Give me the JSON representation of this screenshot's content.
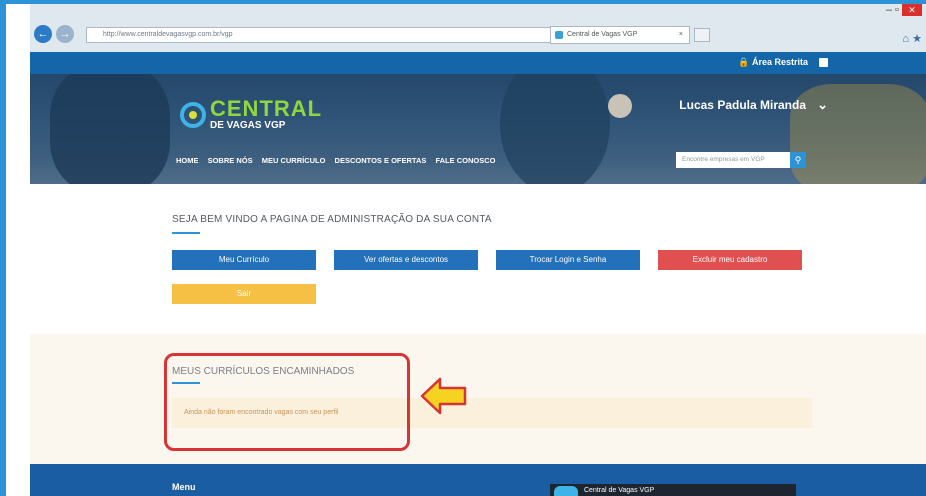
{
  "browser": {
    "url": "http://www.centraldevagasvgp.com.br/vgp",
    "tab_title": "Central de Vagas VGP",
    "tab_close": "×"
  },
  "topbar": {
    "restricted_area": "Área Restrita"
  },
  "header": {
    "logo_main": "CENTRAL",
    "logo_sub": "DE VAGAS VGP",
    "user_name": "Lucas Padula Miranda",
    "nav": [
      "HOME",
      "SOBRE NÓS",
      "MEU CURRÍCULO",
      "DESCONTOS E OFERTAS",
      "FALE CONOSCO"
    ],
    "search_placeholder": "Encontre empresas em VGP"
  },
  "admin": {
    "welcome": "SEJA BEM VINDO A PAGINA DE ADMINISTRAÇÃO DA SUA CONTA",
    "buttons": {
      "my_cv": "Meu Currículo",
      "offers": "Ver ofertas e descontos",
      "change_login": "Trocar Login e Senha",
      "delete": "Excluir meu cadastro",
      "exit": "Sair"
    }
  },
  "forwarded": {
    "title": "MEUS CURRÍCULOS ENCAMINHADOS",
    "empty_message": "Ainda não foram encontrado vagas com seu perfil"
  },
  "footer": {
    "menu_title": "Menu",
    "fb_name": "Central de Vagas VGP"
  },
  "colors": {
    "primary_blue": "#2370bb",
    "danger_red": "#e05050",
    "warning_yellow": "#f5c044",
    "highlight_red": "#d83335",
    "arrow_yellow": "#f7d321"
  }
}
